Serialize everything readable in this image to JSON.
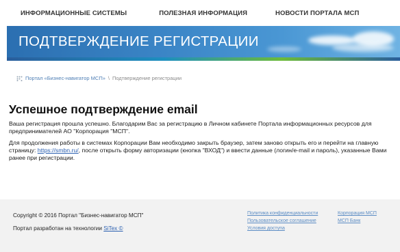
{
  "nav": {
    "items": [
      {
        "label": "ИНФОРМАЦИОННЫЕ СИСТЕМЫ"
      },
      {
        "label": "ПОЛЕЗНАЯ ИНФОРМАЦИЯ"
      },
      {
        "label": "НОВОСТИ ПОРТАЛА МСП"
      }
    ]
  },
  "banner": {
    "title": "ПОДТВЕРЖДЕНИЕ РЕГИСТРАЦИИ"
  },
  "breadcrumb": {
    "icon": "grid-icon",
    "portal_link": "Портал «Бизнес-навигатор МСП»",
    "separator": "\\",
    "current": "Подтверждение регистрации"
  },
  "main": {
    "heading": "Успешное подтверждение email",
    "paragraph1": "Ваша регистрация прошла успешно. Благодарим Вас за регистрацию в Личном кабинете Портала информационных ресурсов для предпринимателей АО \"Корпорация \"МСП\".",
    "paragraph2_before": "Для продолжения работы в системах Корпорации Вам необходимо закрыть браузер, затем заново открыть его и перейти на главную страницу: ",
    "paragraph2_link": "https://smbn.ru/",
    "paragraph2_after": ", после открыть форму авторизации (кнопка \"ВХОД\") и ввести данные (логин/e-mail и пароль), указанные Вами ранее при регистрации."
  },
  "footer": {
    "copyright": "Copyright © 2016 Портал \"Бизнес-навигатор МСП\"",
    "tech_prefix": "Портал разработан на технологии ",
    "tech_link": "SiTex ©",
    "links_col1": [
      {
        "label": "Политика конфиденциальности"
      },
      {
        "label": "Пользовательское соглашение"
      },
      {
        "label": "Условия доступа"
      }
    ],
    "links_col2": [
      {
        "label": "Корпорация МСП"
      },
      {
        "label": "МСП Банк"
      }
    ]
  },
  "colors": {
    "banner": "#3b85c6",
    "link": "#2a5fb0",
    "footer_bg": "#f2f2f2"
  }
}
